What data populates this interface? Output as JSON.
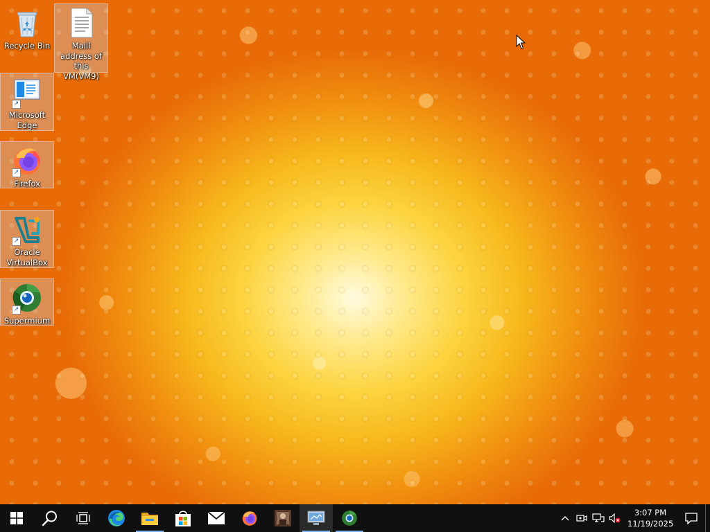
{
  "desktop": {
    "icons": [
      {
        "label": "Recycle Bin",
        "icon": "recycle-bin-icon"
      },
      {
        "label": "Maill address of this VM(VM9)",
        "icon": "text-document-icon"
      },
      {
        "label": "Microsoft Edge",
        "icon": "edge-icon"
      },
      {
        "label": "Firefox",
        "icon": "firefox-icon"
      },
      {
        "label": "Oracle VirtualBox",
        "icon": "virtualbox-icon"
      },
      {
        "label": "Supermium",
        "icon": "supermium-icon"
      }
    ]
  },
  "taskbar": {
    "buttons": [
      {
        "icon": "windows-start-icon"
      },
      {
        "icon": "search-icon"
      },
      {
        "icon": "task-view-icon"
      },
      {
        "icon": "edge-icon"
      },
      {
        "icon": "file-explorer-icon"
      },
      {
        "icon": "microsoft-store-icon"
      },
      {
        "icon": "mail-icon"
      },
      {
        "icon": "firefox-icon"
      },
      {
        "icon": "app-icon"
      },
      {
        "icon": "remote-desktop-icon"
      },
      {
        "icon": "supermium-icon"
      }
    ],
    "tray": {
      "icons": [
        "chevron-up-icon",
        "meet-now-icon",
        "network-icon",
        "volume-muted-icon"
      ],
      "time": "3:07 PM",
      "date": "11/19/2025",
      "notification_icon": "notification-icon"
    }
  },
  "colors": {
    "taskbar_bg": "#101010",
    "running_indicator": "#7fb3e8"
  }
}
